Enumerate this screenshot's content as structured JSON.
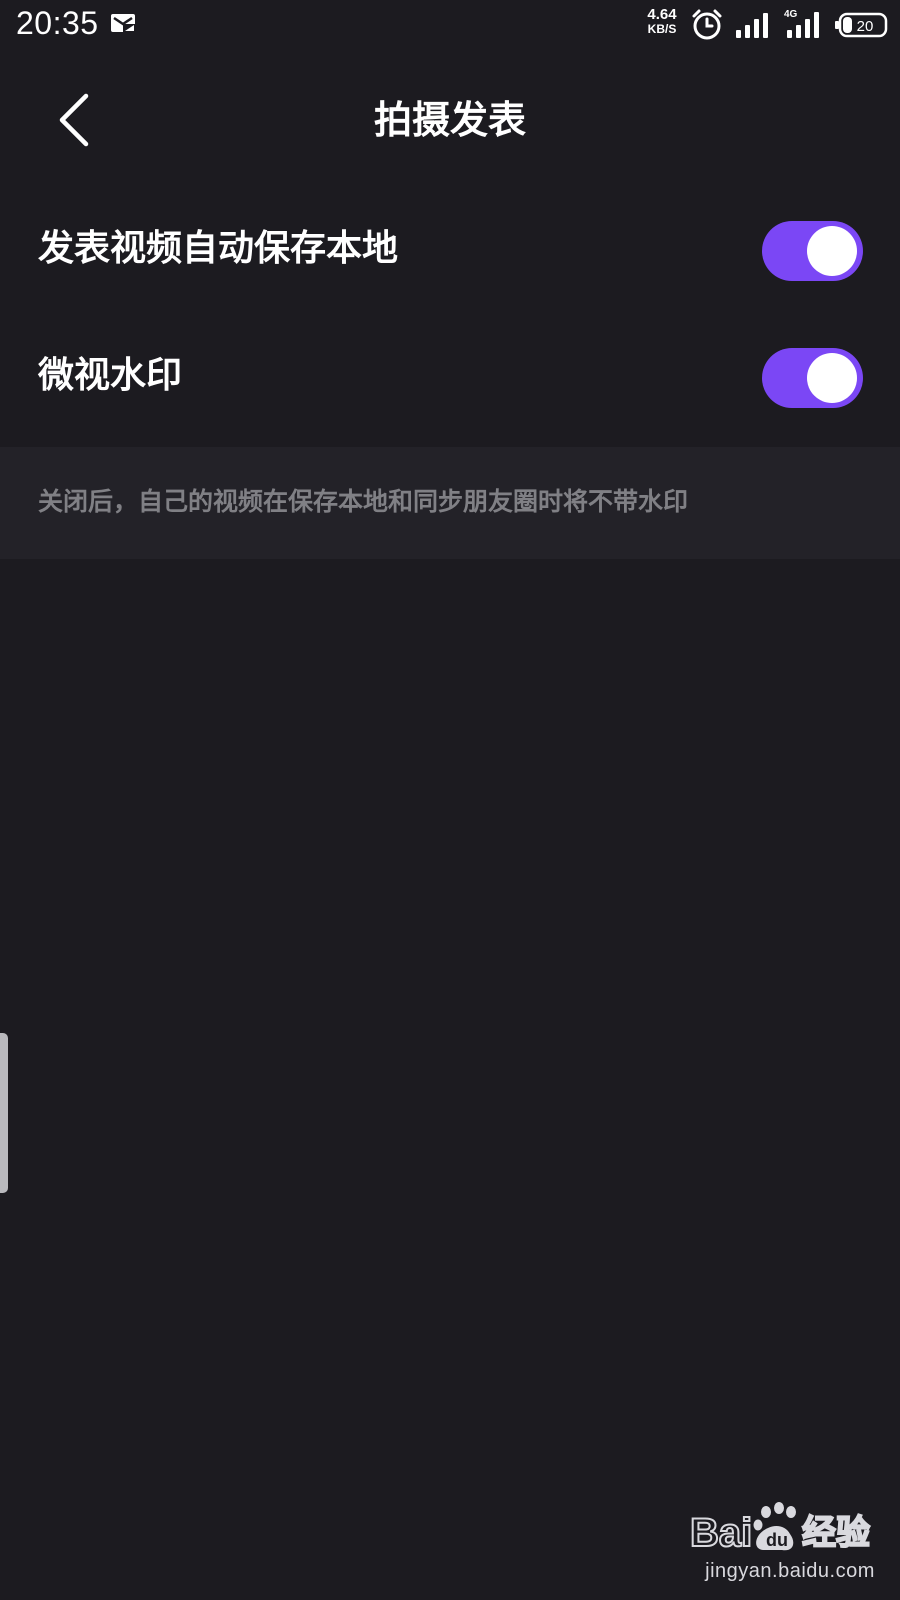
{
  "status_bar": {
    "time": "20:35",
    "net_speed_value": "4.64",
    "net_speed_unit": "KB/S",
    "network_type": "4G",
    "battery_level": "20",
    "icons": [
      "message-icon",
      "alarm-icon",
      "signal-icon",
      "signal-4g-icon",
      "battery-icon"
    ]
  },
  "header": {
    "title": "拍摄发表",
    "back_icon": "chevron-left-icon"
  },
  "settings": [
    {
      "label": "发表视频自动保存本地",
      "enabled": true
    },
    {
      "label": "微视水印",
      "enabled": true
    }
  ],
  "hint": "关闭后，自己的视频在保存本地和同步朋友圈时将不带水印",
  "watermark": {
    "brand": "Baidu经验",
    "url": "jingyan.baidu.com"
  },
  "colors": {
    "background": "#1c1b20",
    "panel": "#232228",
    "accent": "#7b47f5",
    "hint_text": "#808085"
  }
}
